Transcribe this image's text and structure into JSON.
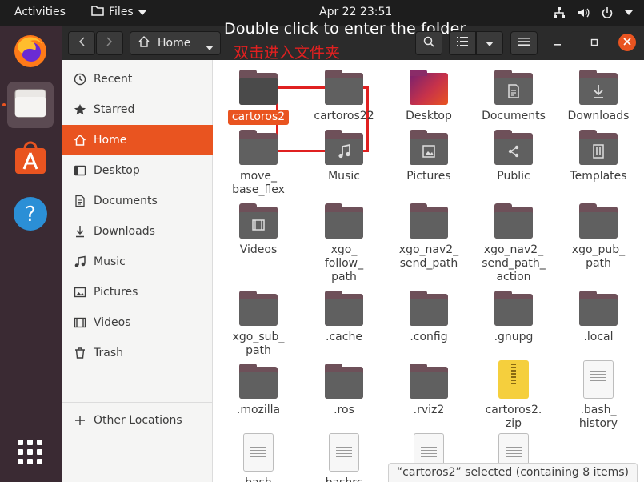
{
  "topbar": {
    "activities": "Activities",
    "app_menu": "Files",
    "clock": "Apr 22  23:51"
  },
  "dock": {
    "apps": [
      "firefox-icon",
      "files-icon",
      "software-icon",
      "help-icon",
      "show-apps-icon"
    ]
  },
  "header": {
    "path_label": "Home",
    "annotation_en": "Double click to enter the folder",
    "annotation_zh": "双击进入文件夹"
  },
  "sidebar": {
    "items": [
      {
        "label": "Recent",
        "icon": "clock-icon"
      },
      {
        "label": "Starred",
        "icon": "star-icon"
      },
      {
        "label": "Home",
        "icon": "home-icon"
      },
      {
        "label": "Desktop",
        "icon": "desktop-icon"
      },
      {
        "label": "Documents",
        "icon": "document-icon"
      },
      {
        "label": "Downloads",
        "icon": "download-icon"
      },
      {
        "label": "Music",
        "icon": "music-icon"
      },
      {
        "label": "Pictures",
        "icon": "picture-icon"
      },
      {
        "label": "Videos",
        "icon": "video-icon"
      },
      {
        "label": "Trash",
        "icon": "trash-icon"
      }
    ],
    "other_locations": "Other Locations",
    "selected": "Home"
  },
  "files": [
    {
      "name": "cartoros2",
      "type": "folder",
      "selected": true
    },
    {
      "name": "cartoros22",
      "type": "folder"
    },
    {
      "name": "Desktop",
      "type": "desktop"
    },
    {
      "name": "Documents",
      "type": "folder",
      "glyph": "document-icon"
    },
    {
      "name": "Downloads",
      "type": "folder",
      "glyph": "download-icon"
    },
    {
      "name": "move_\nbase_flex",
      "type": "folder"
    },
    {
      "name": "Music",
      "type": "folder",
      "glyph": "music-icon"
    },
    {
      "name": "Pictures",
      "type": "folder",
      "glyph": "picture-icon"
    },
    {
      "name": "Public",
      "type": "folder",
      "glyph": "share-icon"
    },
    {
      "name": "Templates",
      "type": "folder",
      "glyph": "template-icon"
    },
    {
      "name": "Videos",
      "type": "folder",
      "glyph": "video-icon"
    },
    {
      "name": "xgo_\nfollow_\npath",
      "type": "folder"
    },
    {
      "name": "xgo_nav2_\nsend_path",
      "type": "folder"
    },
    {
      "name": "xgo_nav2_\nsend_path_\naction",
      "type": "folder"
    },
    {
      "name": "xgo_pub_\npath",
      "type": "folder"
    },
    {
      "name": "xgo_sub_\npath",
      "type": "folder"
    },
    {
      "name": ".cache",
      "type": "folder"
    },
    {
      "name": ".config",
      "type": "folder"
    },
    {
      "name": ".gnupg",
      "type": "folder"
    },
    {
      "name": ".local",
      "type": "folder"
    },
    {
      "name": ".mozilla",
      "type": "folder"
    },
    {
      "name": ".ros",
      "type": "folder"
    },
    {
      "name": ".rviz2",
      "type": "folder"
    },
    {
      "name": "cartoros2.\nzip",
      "type": "zip"
    },
    {
      "name": ".bash_\nhistory",
      "type": "doc"
    },
    {
      "name": "bash",
      "type": "doc"
    },
    {
      "name": "bashrc",
      "type": "doc"
    },
    {
      "name": "",
      "type": "doc"
    },
    {
      "name": "",
      "type": "doc"
    }
  ],
  "status": "“cartoros2” selected  (containing 8 items)"
}
